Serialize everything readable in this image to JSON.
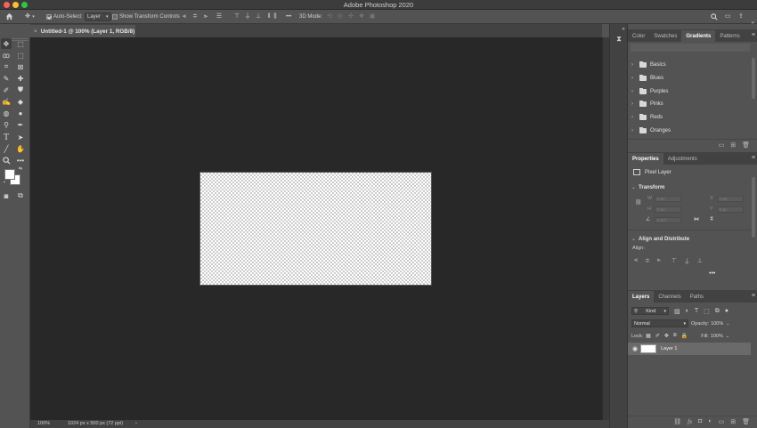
{
  "app": {
    "title": "Adobe Photoshop 2020"
  },
  "options_bar": {
    "home_icon": "home-icon",
    "move_icon": "move-icon",
    "auto_select_label": "Auto-Select:",
    "auto_select_checked": true,
    "auto_select_value": "Layer",
    "show_transform_label": "Show Transform Controls",
    "show_transform_checked": false,
    "mode_3d_label": "3D Mode:",
    "more_label": "•••"
  },
  "document": {
    "tab_title": "Untitled-1 @ 100% (Layer 1, RGB/8)",
    "close_label": "×"
  },
  "status_bar": {
    "zoom": "100%",
    "dimensions": "1024 px x 500 px (72 ppi)",
    "arrow": "›"
  },
  "gradients_panel": {
    "tabs": [
      "Color",
      "Swatches",
      "Gradients",
      "Patterns"
    ],
    "active_tab": "Gradients",
    "folders": [
      "Basics",
      "Blues",
      "Purples",
      "Pinks",
      "Reds",
      "Oranges"
    ]
  },
  "properties_panel": {
    "tabs": [
      "Properties",
      "Adjustments"
    ],
    "active_tab": "Properties",
    "layer_type": "Pixel Layer",
    "transform_title": "Transform",
    "w_label": "W",
    "h_label": "H",
    "x_label": "X",
    "y_label": "Y",
    "w_value": "0 px",
    "h_value": "0 px",
    "x_value": "0 px",
    "y_value": "0 px",
    "angle_value": "0.00°",
    "align_title": "Align and Distribute",
    "align_label": "Align:",
    "more_label": "•••"
  },
  "layers_panel": {
    "tabs": [
      "Layers",
      "Channels",
      "Paths"
    ],
    "active_tab": "Layers",
    "filter_kind": "Kind",
    "blend_mode": "Normal",
    "opacity_label": "Opacity:",
    "opacity_value": "100%",
    "lock_label": "Lock:",
    "fill_label": "Fill:",
    "fill_value": "100%",
    "layers": [
      {
        "name": "Layer 1",
        "visible": true
      }
    ]
  },
  "colors": {
    "app_bg": "#535353",
    "canvas_bg": "#282828",
    "titlebar": "#3c3c3c",
    "foreground_swatch": "#ffffff",
    "background_swatch": "#ffffff"
  }
}
